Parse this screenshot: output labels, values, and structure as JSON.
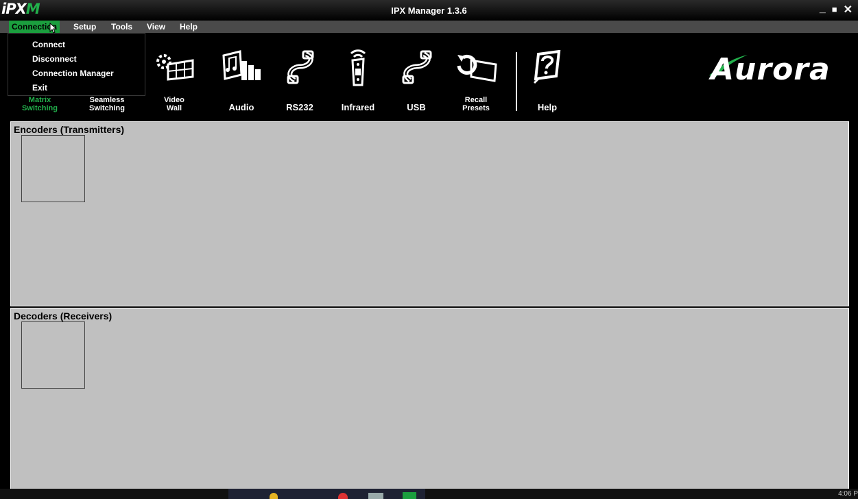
{
  "window": {
    "logo": {
      "prefix": "iPX",
      "suffix": "M"
    },
    "title": "IPX Manager 1.3.6",
    "controls": {
      "minimize": "_",
      "maximize": "■",
      "close": "✕"
    }
  },
  "menu": {
    "items": [
      {
        "label": "Connection",
        "active": true
      },
      {
        "label": "Setup"
      },
      {
        "label": "Tools"
      },
      {
        "label": "View"
      },
      {
        "label": "Help"
      }
    ],
    "dropdown": [
      "Connect",
      "Disconnect",
      "Connection Manager",
      "Exit"
    ]
  },
  "toolbar": {
    "tools": [
      {
        "label_line1": "Matrix",
        "label_line2": "Switching",
        "icon": "matrix-switching-icon",
        "selected": true
      },
      {
        "label_line1": "Seamless",
        "label_line2": "Switching",
        "icon": "seamless-switching-icon"
      },
      {
        "label_line1": "Video",
        "label_line2": "Wall",
        "icon": "video-wall-icon"
      },
      {
        "label_line1": "",
        "label_line2": "Audio",
        "icon": "audio-icon"
      },
      {
        "label_line1": "",
        "label_line2": "RS232",
        "icon": "rs232-icon"
      },
      {
        "label_line1": "",
        "label_line2": "Infrared",
        "icon": "infrared-icon"
      },
      {
        "label_line1": "",
        "label_line2": "USB",
        "icon": "usb-icon"
      },
      {
        "label_line1": "Recall",
        "label_line2": "Presets",
        "icon": "recall-presets-icon"
      },
      {
        "label_line1": "",
        "label_line2": "Help",
        "icon": "help-icon"
      }
    ],
    "brand": "Aurora"
  },
  "encoders": {
    "title": "Encoders (Transmitters)"
  },
  "decoders": {
    "title": "Decoders (Receivers)"
  },
  "taskbar": {
    "clock": "4:06 P"
  },
  "colors": {
    "accent": "#22b14c",
    "panel": "#c0c0c0",
    "background": "#000000"
  }
}
